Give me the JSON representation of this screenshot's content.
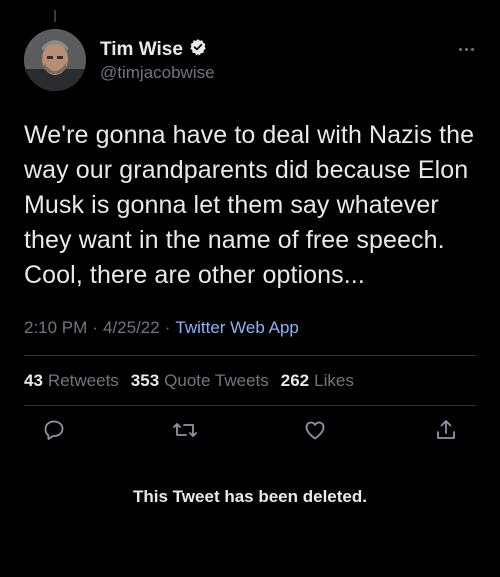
{
  "tweet": {
    "display_name": "Tim Wise",
    "handle": "@timjacobwise",
    "verified": true,
    "text": "We're gonna have to deal with Nazis the way our grandparents did because Elon Musk is gonna let them say whatever they want in the name of free speech. Cool, there are other options...",
    "time": "2:10 PM",
    "date": "4/25/22",
    "source": "Twitter Web App",
    "separator": "·"
  },
  "stats": {
    "retweets_count": "43",
    "retweets_label": "Retweets",
    "quote_count": "353",
    "quote_label": "Quote Tweets",
    "likes_count": "262",
    "likes_label": "Likes"
  },
  "deleted_notice": "This Tweet has been deleted.",
  "colors": {
    "background": "#000000",
    "text": "#e7e9ea",
    "muted": "#71767b",
    "link": "#8ab4f8",
    "verified": "#e7e9ea"
  },
  "icons": [
    "more-icon",
    "verified-badge-icon",
    "reply-icon",
    "retweet-icon",
    "like-icon",
    "share-icon"
  ]
}
